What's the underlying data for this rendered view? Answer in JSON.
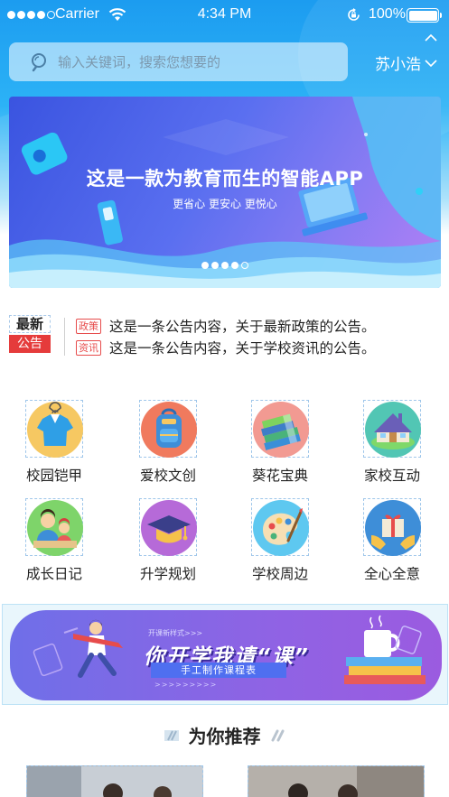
{
  "status_bar": {
    "carrier": "Carrier",
    "time": "4:34 PM",
    "battery": "100%"
  },
  "search": {
    "placeholder": "输入关键词，搜索您想要的"
  },
  "city": {
    "name": "苏小浩"
  },
  "banner": {
    "headline": "这是一款为教育而生的智能APP",
    "subline": "更省心  更安心  更悦心",
    "slide_count": 5,
    "active_slide": 5
  },
  "notices": {
    "title_top": "最新",
    "title_bottom": "公告",
    "items": [
      {
        "tag": "政策",
        "text": "这是一条公告内容，关于最新政策的公告。"
      },
      {
        "tag": "资讯",
        "text": "这是一条公告内容，关于学校资讯的公告。"
      }
    ]
  },
  "grid": {
    "items": [
      {
        "label": "校园铠甲",
        "icon": "school-uniform-icon"
      },
      {
        "label": "爱校文创",
        "icon": "backpack-icon"
      },
      {
        "label": "葵花宝典",
        "icon": "books-icon"
      },
      {
        "label": "家校互动",
        "icon": "house-icon"
      },
      {
        "label": "成长日记",
        "icon": "parent-child-icon"
      },
      {
        "label": "升学规划",
        "icon": "graduation-cap-icon"
      },
      {
        "label": "学校周边",
        "icon": "palette-icon"
      },
      {
        "label": "全心全意",
        "icon": "gift-hands-icon"
      }
    ]
  },
  "promo": {
    "small_text": "开课新样式>>>",
    "headline": "你开学我请“课”",
    "pill": "手工制作课程表",
    "arrows": ">>>>>>>>>"
  },
  "recommend": {
    "title": "为你推荐"
  },
  "colors": {
    "header_blue": "#1c9cf0",
    "notice_red": "#e53b3b",
    "banner_purple": "#5a6ff0"
  }
}
